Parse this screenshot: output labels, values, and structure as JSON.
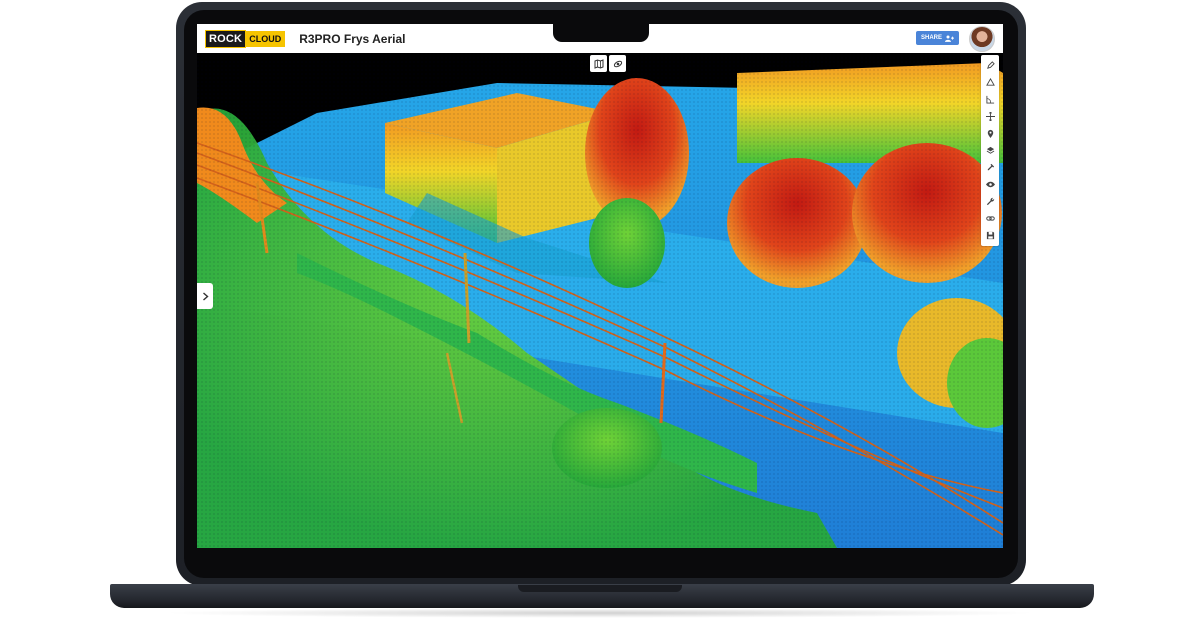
{
  "app": {
    "logo_rock": "ROCK",
    "logo_cloud": "CLOUD",
    "project_title": "R3PRO Frys Aerial",
    "share_label": "SHARE",
    "avatar": "user-avatar"
  },
  "view_toggle": [
    "map-icon",
    "orbit-icon"
  ],
  "toolbar_icons": [
    "pencil-icon",
    "volume-icon",
    "angle-icon",
    "move-icon",
    "pin-icon",
    "layers-icon",
    "dropper-icon",
    "eye-icon",
    "wrench-icon",
    "link-icon",
    "save-icon"
  ],
  "colors": {
    "brand_yellow": "#f6c400",
    "share_blue": "#4a84d8",
    "ground_low": "#1e7fd8",
    "mid_green": "#3bbf2a",
    "high_red": "#d81c10"
  }
}
